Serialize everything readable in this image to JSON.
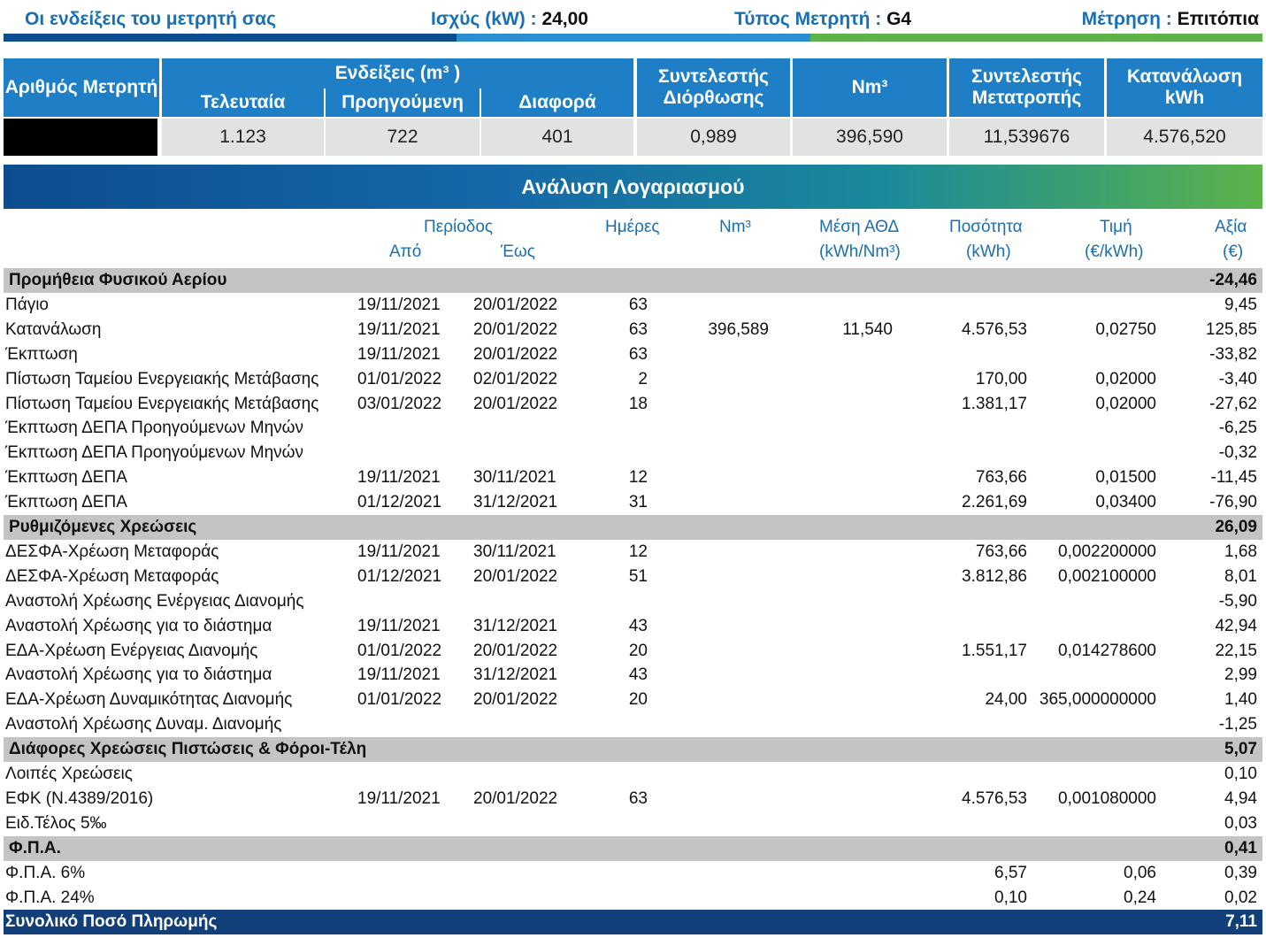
{
  "header": {
    "title": "Οι ενδείξεις του μετρητή σας",
    "power_label": "Ισχύς (kW) :",
    "power_value": "24,00",
    "meter_type_label": "Τύπος Μετρητή :",
    "meter_type_value": "G4",
    "measurement_label": "Μέτρηση :",
    "measurement_value": "Επιτόπια"
  },
  "colors": {
    "dark_blue": "#0c4d8f",
    "mid_blue": "#1e7fc6",
    "green": "#5bb34a",
    "section_gray": "#c4c4c4",
    "total_navy": "#123e7a"
  },
  "meter": {
    "h_number": "Αριθμός Μετρητή",
    "h_readings": "Ενδείξεις (m³ )",
    "h_last": "Τελευταία",
    "h_previous": "Προηγούμενη",
    "h_diff": "Διαφορά",
    "h_correction": "Συντελεστής Διόρθωσης",
    "h_nm3": "Nm³",
    "h_conversion": "Συντελεστής Μετατροπής",
    "h_kwh": "Κατανάλωση kWh",
    "v_number": "",
    "v_last": "1.123",
    "v_previous": "722",
    "v_diff": "401",
    "v_correction": "0,989",
    "v_nm3": "396,590",
    "v_conversion": "11,539676",
    "v_kwh": "4.576,520"
  },
  "analysis": {
    "title": "Ανάλυση Λογαριασμού",
    "columns": {
      "period": "Περίοδος",
      "from": "Από",
      "to": "Έως",
      "days": "Ημέρες",
      "nm3": "Nm³",
      "ath1": "Μέση ΑΘΔ",
      "ath2": "(kWh/Nm³)",
      "qty1": "Ποσότητα",
      "qty2": "(kWh)",
      "price1": "Τιμή",
      "price2": "(€/kWh)",
      "value1": "Αξία",
      "value2": "(€)"
    },
    "rows": [
      {
        "type": "section",
        "label": "Προμήθεια Φυσικού Αερίου",
        "from": "",
        "to": "",
        "days": "",
        "nm3": "",
        "ath": "",
        "qty": "",
        "price": "",
        "value": "-24,46"
      },
      {
        "type": "item",
        "label": "Πάγιο",
        "from": "19/11/2021",
        "to": "20/01/2022",
        "days": "63",
        "nm3": "",
        "ath": "",
        "qty": "",
        "price": "",
        "value": "9,45"
      },
      {
        "type": "item",
        "label": "Κατανάλωση",
        "from": "19/11/2021",
        "to": "20/01/2022",
        "days": "63",
        "nm3": "396,589",
        "ath": "11,540",
        "qty": "4.576,53",
        "price": "0,02750",
        "value": "125,85"
      },
      {
        "type": "item",
        "label": "Έκπτωση",
        "from": "19/11/2021",
        "to": "20/01/2022",
        "days": "63",
        "nm3": "",
        "ath": "",
        "qty": "",
        "price": "",
        "value": "-33,82"
      },
      {
        "type": "item",
        "label": "Πίστωση Ταμείου Ενεργειακής Μετάβασης",
        "from": "01/01/2022",
        "to": "02/01/2022",
        "days": "2",
        "nm3": "",
        "ath": "",
        "qty": "170,00",
        "price": "0,02000",
        "value": "-3,40"
      },
      {
        "type": "item",
        "label": "Πίστωση Ταμείου Ενεργειακής Μετάβασης",
        "from": "03/01/2022",
        "to": "20/01/2022",
        "days": "18",
        "nm3": "",
        "ath": "",
        "qty": "1.381,17",
        "price": "0,02000",
        "value": "-27,62"
      },
      {
        "type": "item",
        "label": "Έκπτωση ΔΕΠΑ Προηγούμενων Μηνών",
        "from": "",
        "to": "",
        "days": "",
        "nm3": "",
        "ath": "",
        "qty": "",
        "price": "",
        "value": "-6,25"
      },
      {
        "type": "item",
        "label": "Έκπτωση ΔΕΠΑ Προηγούμενων Μηνών",
        "from": "",
        "to": "",
        "days": "",
        "nm3": "",
        "ath": "",
        "qty": "",
        "price": "",
        "value": "-0,32"
      },
      {
        "type": "item",
        "label": "Έκπτωση ΔΕΠΑ",
        "from": "19/11/2021",
        "to": "30/11/2021",
        "days": "12",
        "nm3": "",
        "ath": "",
        "qty": "763,66",
        "price": "0,01500",
        "value": "-11,45"
      },
      {
        "type": "item",
        "label": "Έκπτωση ΔΕΠΑ",
        "from": "01/12/2021",
        "to": "31/12/2021",
        "days": "31",
        "nm3": "",
        "ath": "",
        "qty": "2.261,69",
        "price": "0,03400",
        "value": "-76,90"
      },
      {
        "type": "section",
        "label": "Ρυθμιζόμενες Χρεώσεις",
        "from": "",
        "to": "",
        "days": "",
        "nm3": "",
        "ath": "",
        "qty": "",
        "price": "",
        "value": "26,09"
      },
      {
        "type": "item",
        "label": "ΔΕΣΦΑ-Χρέωση Μεταφοράς",
        "from": "19/11/2021",
        "to": "30/11/2021",
        "days": "12",
        "nm3": "",
        "ath": "",
        "qty": "763,66",
        "price": "0,002200000",
        "value": "1,68"
      },
      {
        "type": "item",
        "label": "ΔΕΣΦΑ-Χρέωση Μεταφοράς",
        "from": "01/12/2021",
        "to": "20/01/2022",
        "days": "51",
        "nm3": "",
        "ath": "",
        "qty": "3.812,86",
        "price": "0,002100000",
        "value": "8,01"
      },
      {
        "type": "item",
        "label": "Αναστολή Χρέωσης Ενέργειας Διανομής",
        "from": "",
        "to": "",
        "days": "",
        "nm3": "",
        "ath": "",
        "qty": "",
        "price": "",
        "value": "-5,90"
      },
      {
        "type": "item",
        "label": "Αναστολή Χρέωσης για το διάστημα",
        "from": "19/11/2021",
        "to": "31/12/2021",
        "days": "43",
        "nm3": "",
        "ath": "",
        "qty": "",
        "price": "",
        "value": "42,94"
      },
      {
        "type": "item",
        "label": "ΕΔΑ-Χρέωση Ενέργειας Διανομής",
        "from": "01/01/2022",
        "to": "20/01/2022",
        "days": "20",
        "nm3": "",
        "ath": "",
        "qty": "1.551,17",
        "price": "0,014278600",
        "value": "22,15"
      },
      {
        "type": "item",
        "label": "Αναστολή Χρέωσης για το διάστημα",
        "from": "19/11/2021",
        "to": "31/12/2021",
        "days": "43",
        "nm3": "",
        "ath": "",
        "qty": "",
        "price": "",
        "value": "2,99"
      },
      {
        "type": "item",
        "label": "ΕΔΑ-Χρέωση Δυναμικότητας Διανομής",
        "from": "01/01/2022",
        "to": "20/01/2022",
        "days": "20",
        "nm3": "",
        "ath": "",
        "qty": "24,00",
        "price": "365,000000000",
        "value": "1,40"
      },
      {
        "type": "item",
        "label": "Αναστολή Χρέωσης Δυναμ. Διανομής",
        "from": "",
        "to": "",
        "days": "",
        "nm3": "",
        "ath": "",
        "qty": "",
        "price": "",
        "value": "-1,25"
      },
      {
        "type": "section",
        "label": "Διάφορες Χρεώσεις Πιστώσεις & Φόροι-Τέλη",
        "from": "",
        "to": "",
        "days": "",
        "nm3": "",
        "ath": "",
        "qty": "",
        "price": "",
        "value": "5,07"
      },
      {
        "type": "item",
        "label": "Λοιπές Χρεώσεις",
        "from": "",
        "to": "",
        "days": "",
        "nm3": "",
        "ath": "",
        "qty": "",
        "price": "",
        "value": "0,10"
      },
      {
        "type": "item",
        "label": "ΕΦΚ (Ν.4389/2016)",
        "from": "19/11/2021",
        "to": "20/01/2022",
        "days": "63",
        "nm3": "",
        "ath": "",
        "qty": "4.576,53",
        "price": "0,001080000",
        "value": "4,94"
      },
      {
        "type": "item",
        "label": "Ειδ.Τέλος 5‰",
        "from": "",
        "to": "",
        "days": "",
        "nm3": "",
        "ath": "",
        "qty": "",
        "price": "",
        "value": "0,03"
      },
      {
        "type": "section",
        "label": "Φ.Π.Α.",
        "from": "",
        "to": "",
        "days": "",
        "nm3": "",
        "ath": "",
        "qty": "",
        "price": "",
        "value": "0,41"
      },
      {
        "type": "item",
        "label": "Φ.Π.Α. 6%",
        "from": "",
        "to": "",
        "days": "",
        "nm3": "",
        "ath": "",
        "qty": "6,57",
        "price": "0,06",
        "value": "0,39"
      },
      {
        "type": "item",
        "label": "Φ.Π.Α. 24%",
        "from": "",
        "to": "",
        "days": "",
        "nm3": "",
        "ath": "",
        "qty": "0,10",
        "price": "0,24",
        "value": "0,02"
      },
      {
        "type": "total",
        "label": "Συνολικό Ποσό Πληρωμής",
        "from": "",
        "to": "",
        "days": "",
        "nm3": "",
        "ath": "",
        "qty": "",
        "price": "",
        "value": "7,11"
      }
    ]
  }
}
